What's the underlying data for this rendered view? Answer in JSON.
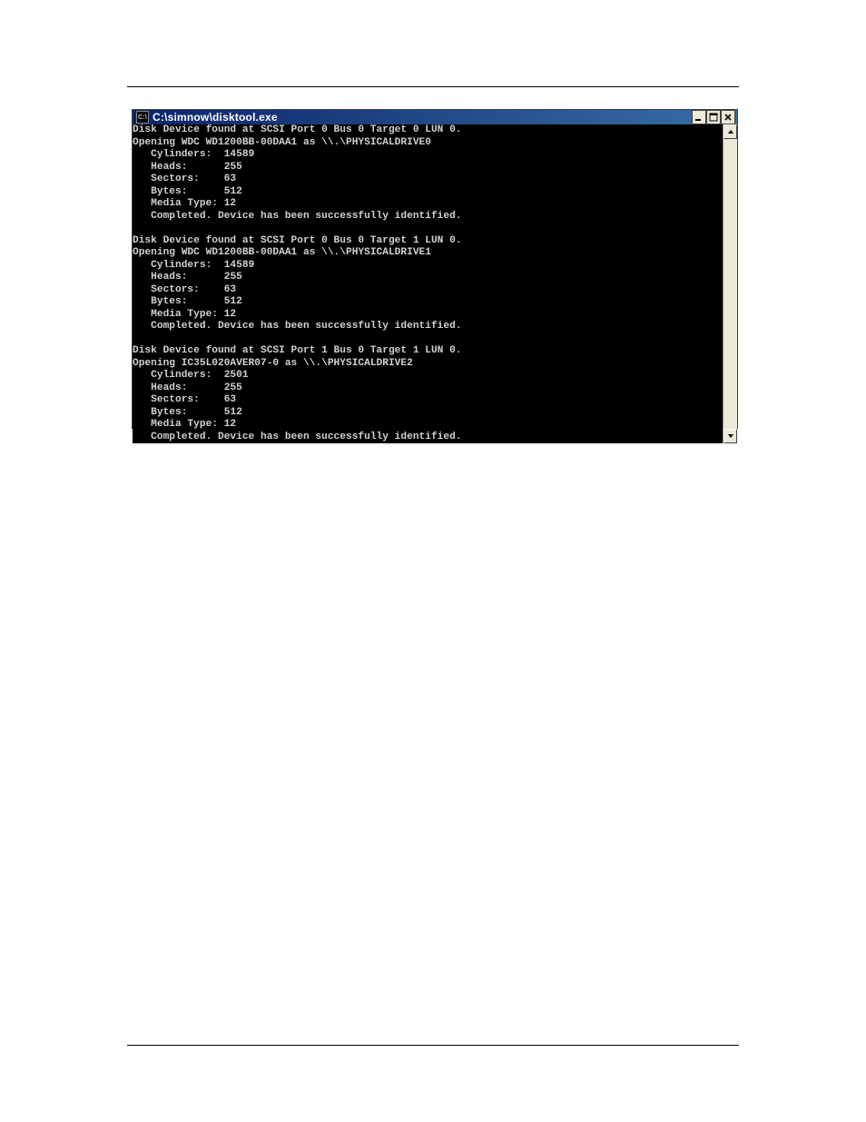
{
  "window": {
    "icon_label": "C:\\",
    "title": "C:\\simnow\\disktool.exe"
  },
  "console": {
    "blocks": [
      {
        "found": "Disk Device found at SCSI Port 0 Bus 0 Target 0 LUN 0.",
        "opening": "Opening WDC WD1200BB-00DAA1 as \\\\.\\PHYSICALDRIVE0",
        "cylinders_label": "   Cylinders:",
        "cylinders_value": "14589",
        "heads_label": "   Heads:",
        "heads_value": "255",
        "sectors_label": "   Sectors:",
        "sectors_value": "63",
        "bytes_label": "   Bytes:",
        "bytes_value": "512",
        "media_label": "   Media Type:",
        "media_value": "12",
        "completed": "   Completed. Device has been successfully identified."
      },
      {
        "found": "Disk Device found at SCSI Port 0 Bus 0 Target 1 LUN 0.",
        "opening": "Opening WDC WD1200BB-00DAA1 as \\\\.\\PHYSICALDRIVE1",
        "cylinders_label": "   Cylinders:",
        "cylinders_value": "14589",
        "heads_label": "   Heads:",
        "heads_value": "255",
        "sectors_label": "   Sectors:",
        "sectors_value": "63",
        "bytes_label": "   Bytes:",
        "bytes_value": "512",
        "media_label": "   Media Type:",
        "media_value": "12",
        "completed": "   Completed. Device has been successfully identified."
      },
      {
        "found": "Disk Device found at SCSI Port 1 Bus 0 Target 1 LUN 0.",
        "opening": "Opening IC35L020AVER07-0 as \\\\.\\PHYSICALDRIVE2",
        "cylinders_label": "   Cylinders:",
        "cylinders_value": "2501",
        "heads_label": "   Heads:",
        "heads_value": "255",
        "sectors_label": "   Sectors:",
        "sectors_value": "63",
        "bytes_label": "   Bytes:",
        "bytes_value": "512",
        "media_label": "   Media Type:",
        "media_value": "12",
        "completed": "   Completed. Device has been successfully identified."
      }
    ]
  }
}
